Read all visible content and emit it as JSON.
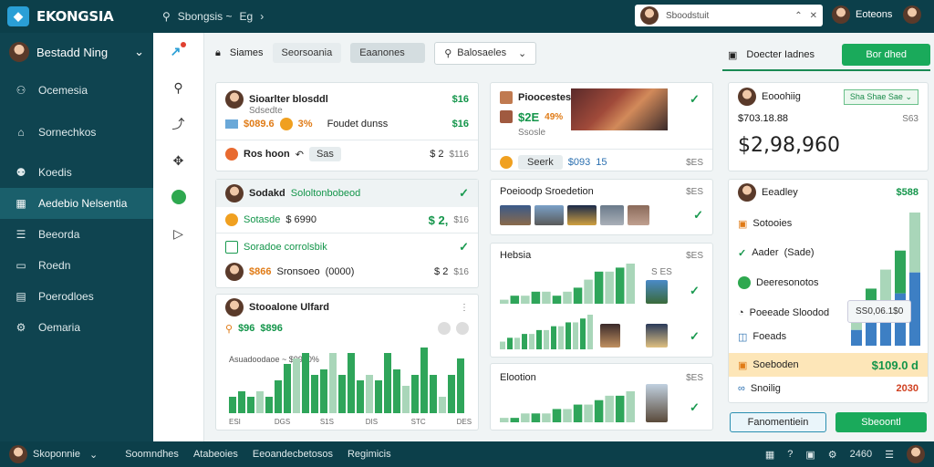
{
  "app": {
    "name": "EKONGSIA"
  },
  "topbar": {
    "search_text": "Sbongsis ~",
    "search_extra": "Eg",
    "search_box_placeholder": "Sboodstuit",
    "user_name": "Eoteons"
  },
  "sidebar": {
    "user_name": "Bestadd Ning",
    "items": [
      {
        "label": "Ocemesia",
        "icon": "people-icon"
      },
      {
        "label": "Sornechkos",
        "icon": "home-icon"
      },
      {
        "label": "Koedis",
        "icon": "users-icon"
      },
      {
        "label": "Aedebio Nelsentia",
        "icon": "grid-icon",
        "active": true
      },
      {
        "label": "Beeorda",
        "icon": "list-icon"
      },
      {
        "label": "Roedn",
        "icon": "window-icon"
      },
      {
        "label": "Poerodloes",
        "icon": "doc-icon"
      },
      {
        "label": "Oemaria",
        "icon": "gear-icon"
      }
    ]
  },
  "filters": {
    "label": "Siames",
    "chip1": "Seorsoania",
    "chip2": "Eaanones",
    "select": "Balosaeles"
  },
  "right_tabs": {
    "tab": "Doecter Iadnes",
    "button": "Bor dhed"
  },
  "col1": {
    "card1": {
      "title": "Sioarlter blosddl",
      "sub": "Sdsedte",
      "badge": "$16",
      "amount": "$089.6",
      "pct": "3%",
      "note": "Foudet dunss",
      "note_amt": "$16",
      "footer_name": "Ros hoon",
      "footer_btn": "Sas",
      "footer_val": "$ 2",
      "footer_sub": "$116"
    },
    "card2": {
      "header": "Sodakd",
      "header_sub": "Sololtonbobeod",
      "row1_label": "Sotasde",
      "row1_amt": "$ 6990",
      "row1_val": "$ 2,",
      "row1_sub": "$16",
      "sec_title": "Soradoe corrolsbik",
      "row2_amt": "$866",
      "row2_label": "Sronsoeo",
      "row2_paren": "(0000)",
      "row2_val": "$ 2",
      "row2_sub": "$16"
    },
    "card3": {
      "title": "Stooalone Ulfard",
      "amt1": "$96",
      "amt2": "$896",
      "legend": "Asuadoodaoe ~ $9990%"
    },
    "chart": {
      "type": "bar",
      "values": [
        3,
        4,
        3,
        4,
        3,
        6,
        9,
        10,
        11,
        7,
        8,
        11,
        7,
        11,
        6,
        7,
        6,
        11,
        8,
        5,
        7,
        12,
        7,
        3,
        7,
        10
      ],
      "xticks": [
        "ESI",
        "DGS",
        "S1S",
        "DIS",
        "STC",
        "DES"
      ]
    }
  },
  "col2": {
    "card1": {
      "title": "Pioocestes",
      "amt": "$2E",
      "pct": "49%",
      "sub": "Ssosle",
      "footer_label": "Seerk",
      "footer_val": "$093",
      "footer_val2": "15",
      "footer_tag": "$ES"
    },
    "card2": {
      "title": "Poeioodp Sroedetion",
      "tag": "$ES"
    },
    "card3": {
      "title": "Hebsia",
      "tag": "$ES",
      "tag2": "S ES"
    },
    "card4": {
      "title": "Elootion",
      "tag": "$ES"
    },
    "bars_a": [
      1,
      2,
      2,
      3,
      3,
      2,
      3,
      4,
      6,
      8,
      8,
      9,
      10
    ],
    "bars_b": [
      2,
      3,
      3,
      4,
      4,
      5,
      5,
      6,
      6,
      7,
      7,
      8,
      9
    ],
    "bars_c": [
      1,
      1,
      2,
      2,
      2,
      3,
      3,
      4,
      4,
      5,
      6,
      6,
      7
    ]
  },
  "col3": {
    "card1": {
      "title": "Eooohiig",
      "badge": "Sha Shae Sae",
      "small": "$703.18.88",
      "small_tag": "S63",
      "big": "$2,98,960"
    },
    "card2": {
      "title": "Eeadley",
      "badge": "$588",
      "rows": [
        {
          "label": "Sotooies"
        },
        {
          "label": "Aader",
          "paren": "(Sade)"
        },
        {
          "label": "Deeresonotos"
        },
        {
          "label": "Poeeade Sloodod"
        },
        {
          "label": "Foeads"
        }
      ],
      "tooltip": "SS0,06.1$0",
      "highlight_label": "Soeboden",
      "highlight_val": "$109.0 d",
      "last_label": "Snoilig",
      "last_val": "2030"
    },
    "stack_bars": [
      3,
      6,
      8,
      10,
      14
    ],
    "buttons": {
      "outline": "Fanomentiein",
      "green": "Sbeoontl"
    }
  },
  "bottombar": {
    "user": "Skoponnie",
    "links": [
      "Soomndhes",
      "Atabeoies",
      "Eeoandecbetosos",
      "Regimicis"
    ],
    "right_val": "2460"
  },
  "colors": {
    "primary": "#0c3f4a",
    "accent": "#1aaa5b",
    "bar": "#2fa55a",
    "bar_light": "#a9d6b9",
    "blue": "#3d7fc4",
    "orange": "#e07b16"
  }
}
